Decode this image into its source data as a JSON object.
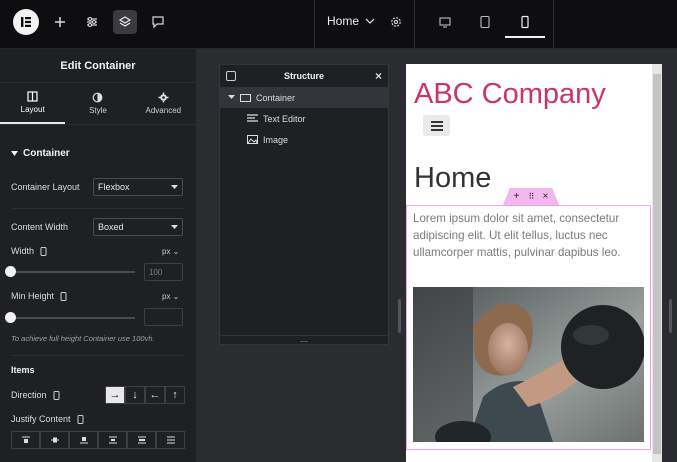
{
  "topbar": {
    "page_name": "Home",
    "icons": [
      "elementor-logo-icon",
      "plus-icon",
      "settings-sliders-icon",
      "layers-icon",
      "comment-icon",
      "gear-icon",
      "desktop-icon",
      "tablet-icon",
      "mobile-icon"
    ]
  },
  "panel": {
    "title": "Edit Container",
    "tabs": [
      {
        "label": "Layout"
      },
      {
        "label": "Style"
      },
      {
        "label": "Advanced"
      }
    ],
    "section_title": "Container",
    "container_layout_label": "Container Layout",
    "container_layout_value": "Flexbox",
    "content_width_label": "Content Width",
    "content_width_value": "Boxed",
    "width_label": "Width",
    "width_unit": "px",
    "width_placeholder": "100",
    "min_height_label": "Min Height",
    "min_height_unit": "px",
    "hint": "To achieve full height Container use 100vh.",
    "items_title": "Items",
    "direction_label": "Direction",
    "justify_label": "Justify Content"
  },
  "structure": {
    "title": "Structure",
    "items": [
      {
        "label": "Container"
      },
      {
        "label": "Text Editor"
      },
      {
        "label": "Image"
      }
    ]
  },
  "preview": {
    "brand": "ABC Company",
    "heading": "Home",
    "body": "Lorem ipsum dolor sit amet, consectetur adipiscing elit. Ut elit tellus, luctus nec ullamcorper mattis, pulvinar dapibus leo."
  },
  "colors": {
    "brand": "#cc3366",
    "container_outline": "#f0a4e6",
    "panel_bg": "#1f2023",
    "topbar_bg": "#0e0e10"
  }
}
